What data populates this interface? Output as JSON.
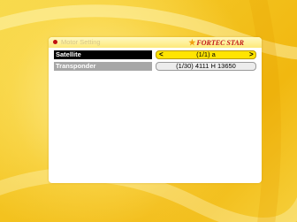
{
  "header": {
    "title": "Motor Setting",
    "brand": "FORTEC STAR",
    "brand_icon": "star-icon"
  },
  "rows": [
    {
      "label": "Satellite",
      "value": "(1/1) a",
      "left_arrow": "<",
      "right_arrow": ">",
      "selected": true
    },
    {
      "label": "Transponder",
      "value": "(1/30) 4111 H 13650",
      "selected": false
    }
  ],
  "colors": {
    "background": "#f5c418",
    "selected_label_bg": "#000000",
    "selected_value_bg": "#ffe400",
    "label_bg": "#a7a7a7",
    "value_bg": "#ececec",
    "brand": "#c01818",
    "bullet": "#c01010"
  }
}
